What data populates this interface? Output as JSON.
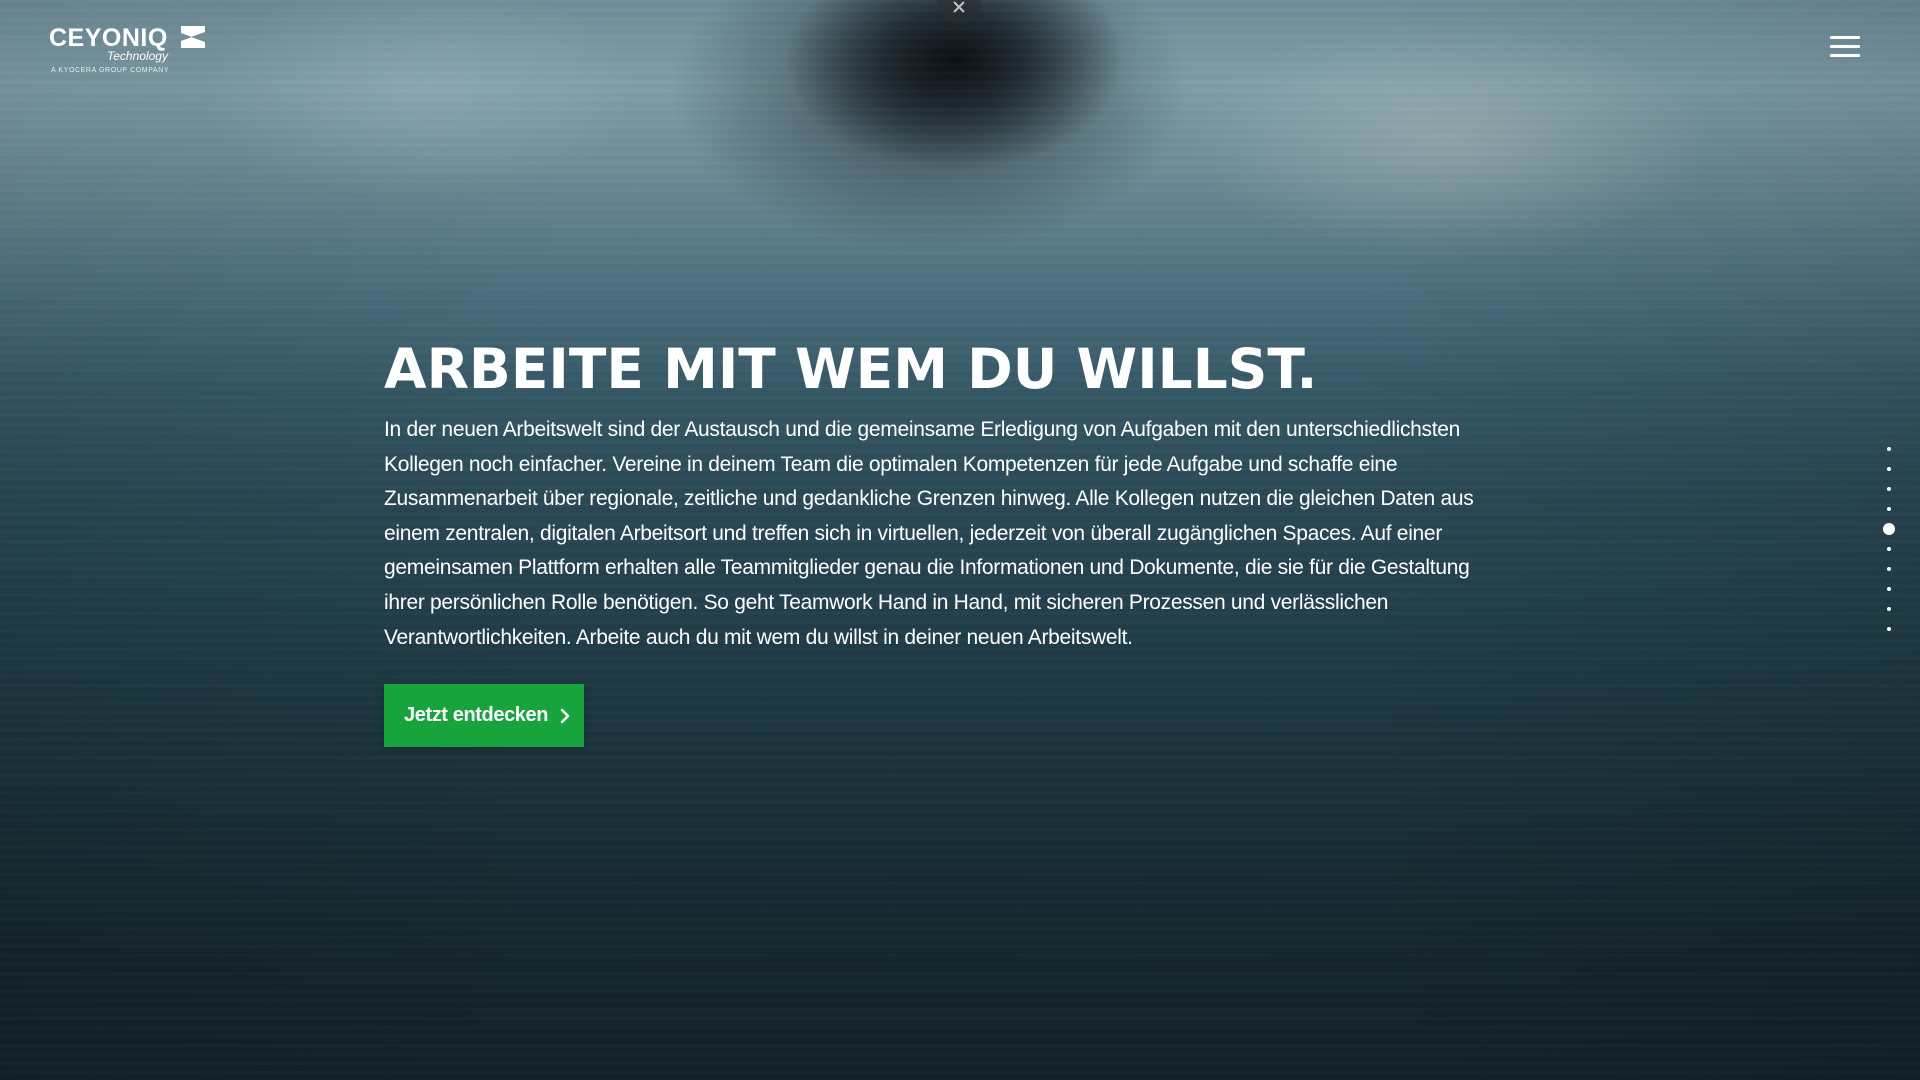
{
  "header": {
    "logo": {
      "wordmark": "CEYONIQ",
      "subline": "Technology",
      "group": "A KYOCERA GROUP COMPANY"
    },
    "menu_icon": "hamburger-menu-icon",
    "close_icon": "close-icon"
  },
  "hero": {
    "title": "ARBEITE MIT WEM DU WILLST.",
    "body": "In der neuen Arbeitswelt sind der Austausch und die gemeinsame Erledigung von Aufgaben mit den unterschiedlichsten Kollegen noch einfacher. Vereine in deinem Team die optimalen Kompetenzen für jede Aufgabe und schaffe eine Zusammenarbeit über regionale, zeitliche und gedankliche Grenzen hinweg. Alle Kollegen nutzen die gleichen Daten aus einem zentralen, digitalen Arbeitsort und treffen sich in virtuellen, jederzeit von überall zugänglichen Spaces. Auf einer gemeinsamen Plattform erhalten alle Teammitglieder genau die Informationen und Dokumente, die sie für die Gestaltung ihrer persönlichen Rolle benötigen. So geht Teamwork Hand in Hand, mit sicheren Prozessen und verlässlichen Verantwortlichkeiten. Arbeite auch du mit wem du willst in deiner neuen Arbeitswelt.",
    "cta_label": "Jetzt entdecken",
    "cta_icon": "chevron-right-icon"
  },
  "slide_nav": {
    "total": 10,
    "active_index": 4
  },
  "colors": {
    "accent": "#17a43c",
    "text": "#ffffff"
  }
}
